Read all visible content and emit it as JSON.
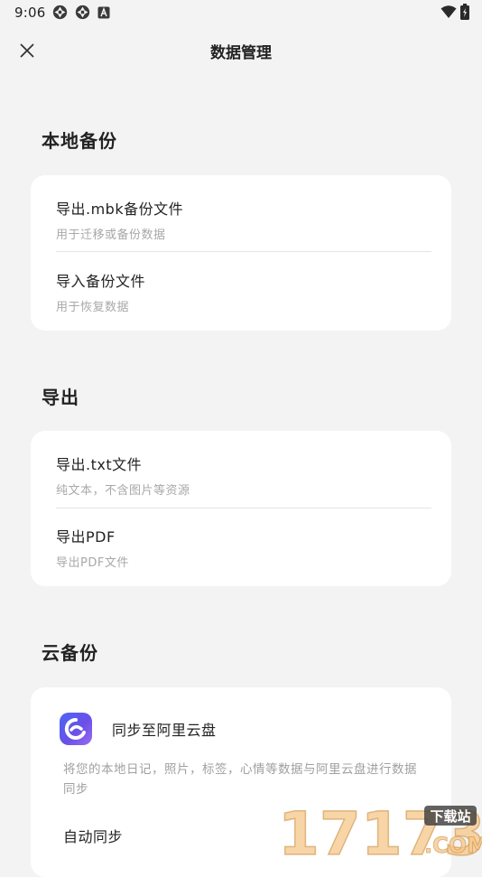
{
  "status_bar": {
    "time": "9:06",
    "left_icons": [
      "aperture-icon",
      "aperture-icon",
      "font-a-icon"
    ],
    "right_icons": [
      "wifi-icon",
      "battery-charging-icon"
    ]
  },
  "app_bar": {
    "close_icon": "close-icon",
    "title": "数据管理"
  },
  "sections": {
    "local_backup": {
      "title": "本地备份",
      "items": [
        {
          "title": "导出.mbk备份文件",
          "subtitle": "用于迁移或备份数据"
        },
        {
          "title": "导入备份文件",
          "subtitle": "用于恢复数据"
        }
      ]
    },
    "export": {
      "title": "导出",
      "items": [
        {
          "title": "导出.txt文件",
          "subtitle": "纯文本，不含图片等资源"
        },
        {
          "title": "导出PDF",
          "subtitle": "导出PDF文件"
        }
      ]
    },
    "cloud_backup": {
      "title": "云备份",
      "service_name": "同步至阿里云盘",
      "description": "将您的本地日记，照片，标签，心情等数据与阿里云盘进行数据同步",
      "auto_sync_label": "自动同步"
    }
  },
  "watermark": {
    "number": "17173",
    "tag": "下载站",
    "domain": ".COM"
  },
  "colors": {
    "background": "#f3f3f3",
    "card": "#ffffff",
    "subtitle": "#a8a8a8",
    "cloud_logo_start": "#4a67f5",
    "cloud_logo_end": "#9a6cf2"
  }
}
